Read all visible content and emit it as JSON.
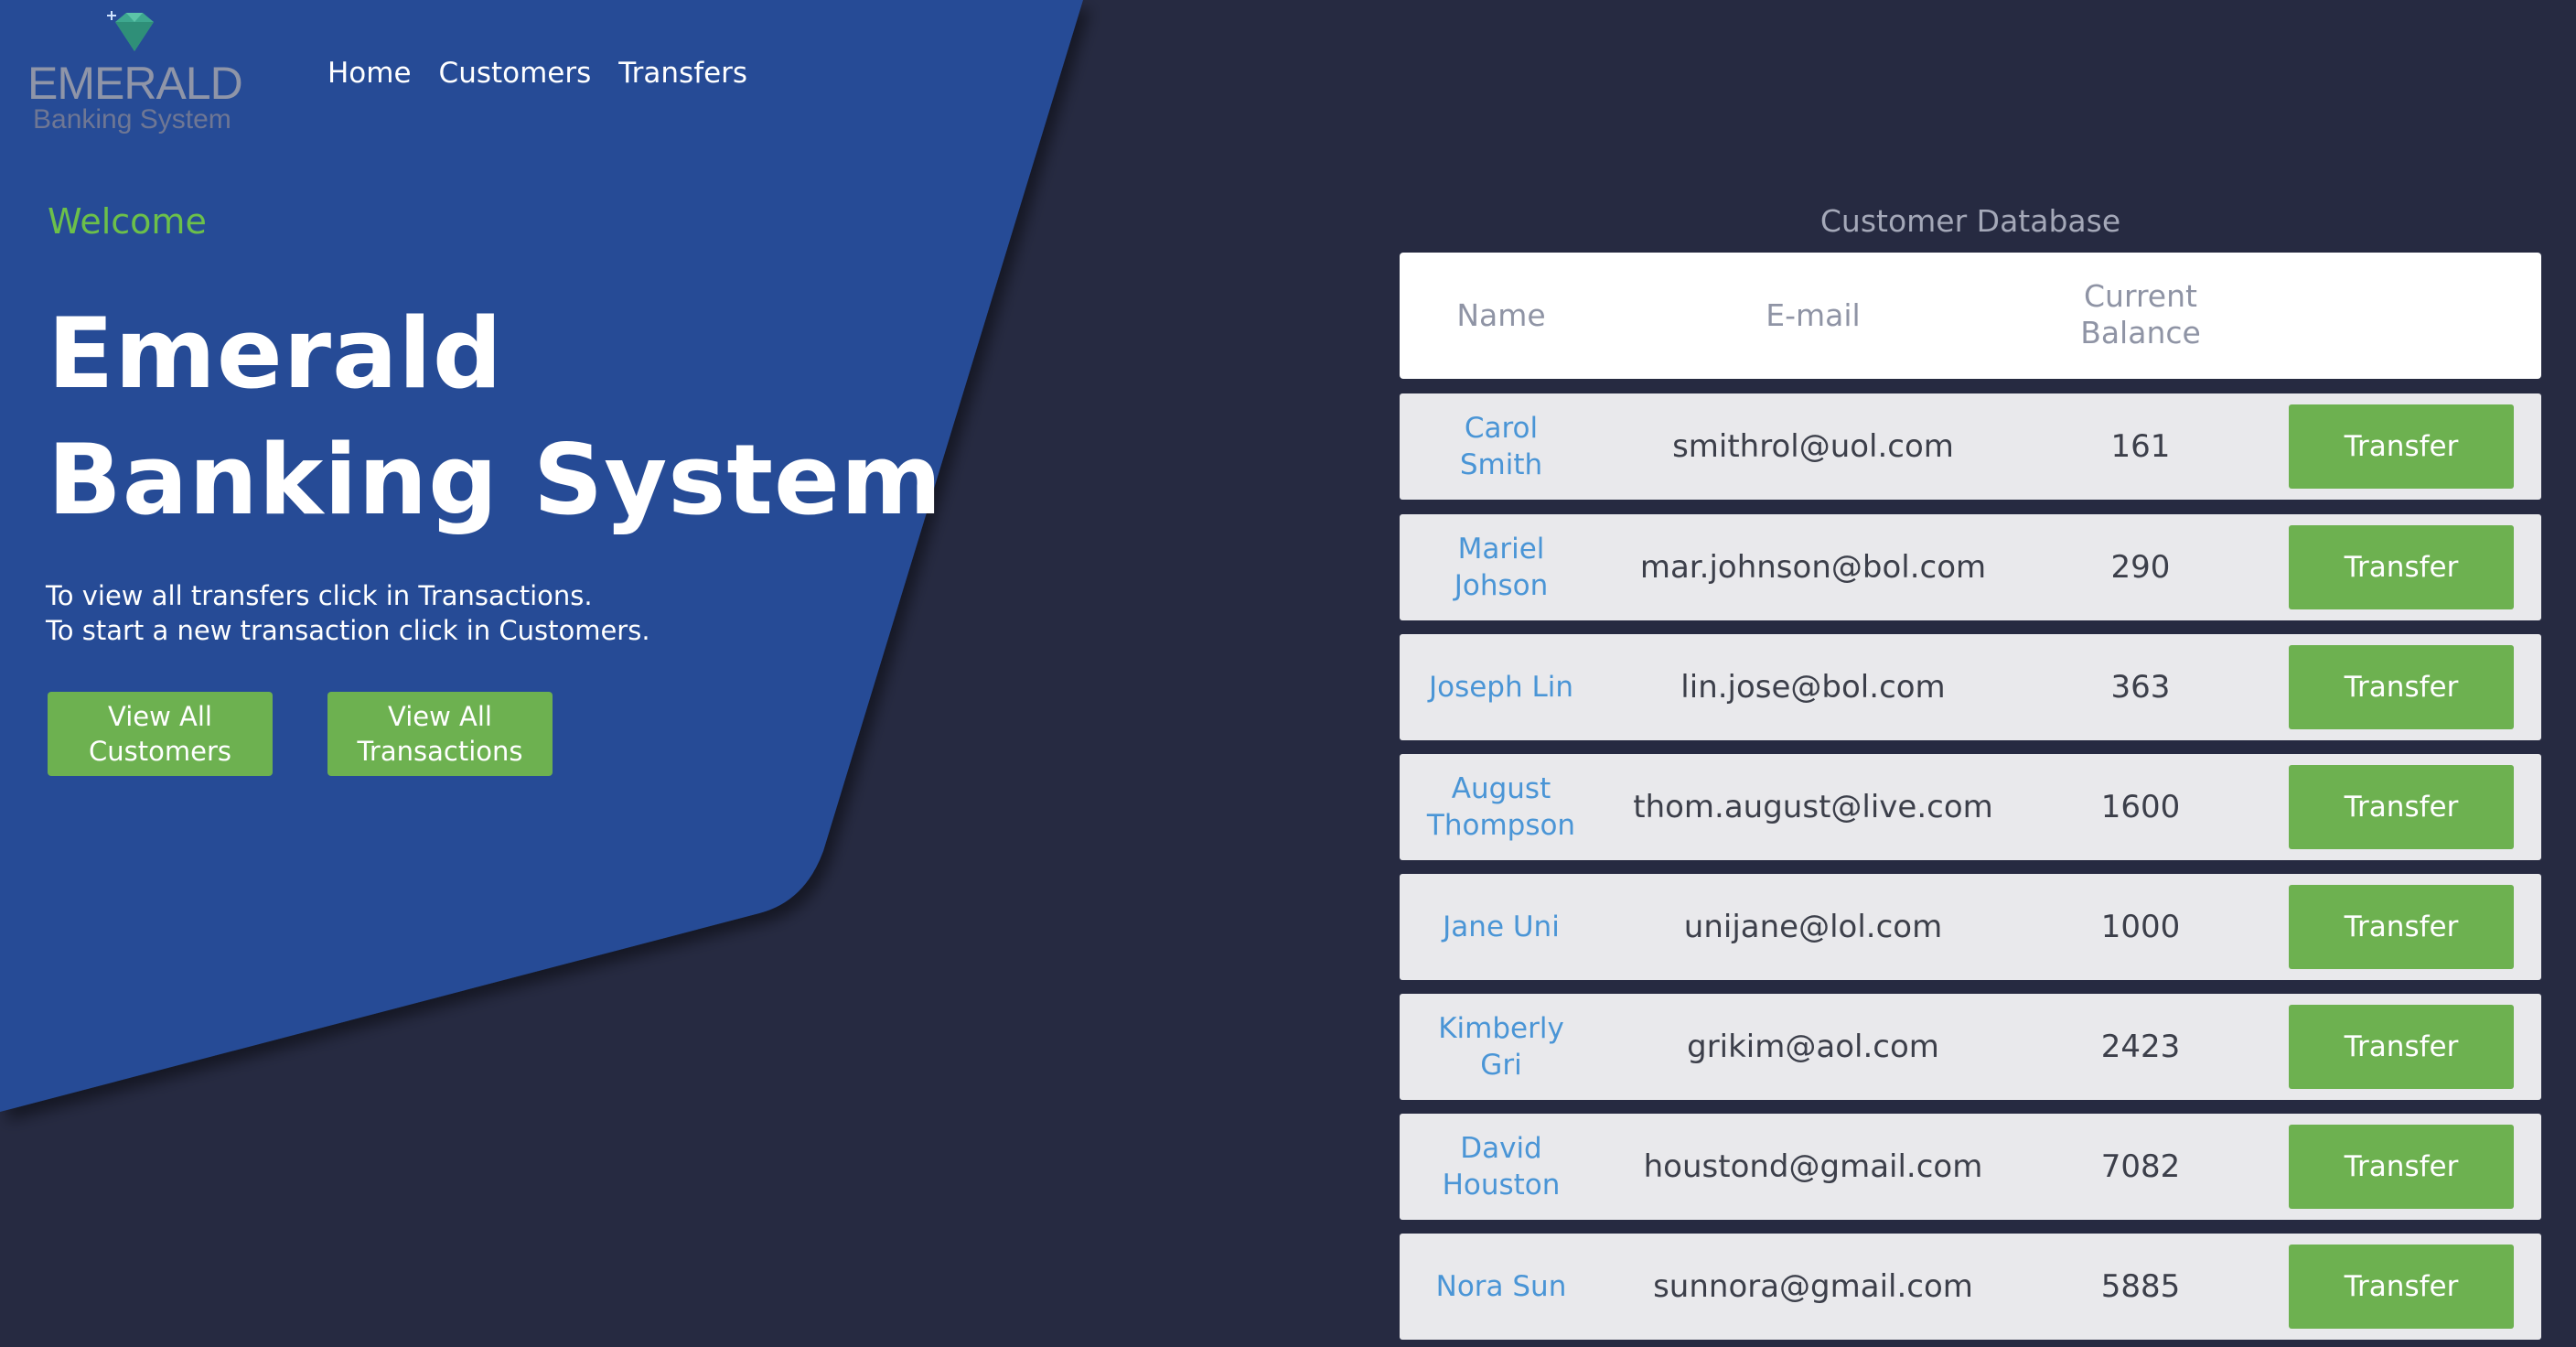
{
  "colors": {
    "background": "#262a41",
    "hero_panel": "#264c96",
    "accent_green": "#6db150",
    "welcome_green": "#6cc04a",
    "name_link": "#4a95d6"
  },
  "logo": {
    "title": "EMERALD",
    "subtitle": "Banking System",
    "icon": "gem-icon"
  },
  "nav": {
    "items": [
      {
        "label": "Home"
      },
      {
        "label": "Customers"
      },
      {
        "label": "Transfers"
      }
    ]
  },
  "hero": {
    "welcome": "Welcome",
    "title_line1": "Emerald",
    "title_line2": "Banking System",
    "text_line1": "To view all transfers click in Transactions.",
    "text_line2": "To start a new transaction click in Customers.",
    "btn_customers_line1": "View All",
    "btn_customers_line2": "Customers",
    "btn_transactions_line1": "View All",
    "btn_transactions_line2": "Transactions"
  },
  "table": {
    "title": "Customer Database",
    "headers": {
      "name": "Name",
      "email": "E-mail",
      "balance_line1": "Current",
      "balance_line2": "Balance"
    },
    "transfer_label": "Transfer",
    "rows": [
      {
        "name_line1": "Carol",
        "name_line2": "Smith",
        "email": "smithrol@uol.com",
        "balance": "161"
      },
      {
        "name_line1": "Mariel",
        "name_line2": "Johson",
        "email": "mar.johnson@bol.com",
        "balance": "290"
      },
      {
        "name_line1": "Joseph Lin",
        "name_line2": "",
        "email": "lin.jose@bol.com",
        "balance": "363"
      },
      {
        "name_line1": "August",
        "name_line2": "Thompson",
        "email": "thom.august@live.com",
        "balance": "1600"
      },
      {
        "name_line1": "Jane Uni",
        "name_line2": "",
        "email": "unijane@lol.com",
        "balance": "1000"
      },
      {
        "name_line1": "Kimberly",
        "name_line2": "Gri",
        "email": "grikim@aol.com",
        "balance": "2423"
      },
      {
        "name_line1": "David",
        "name_line2": "Houston",
        "email": "houstond@gmail.com",
        "balance": "7082"
      },
      {
        "name_line1": "Nora Sun",
        "name_line2": "",
        "email": "sunnora@gmail.com",
        "balance": "5885"
      }
    ]
  }
}
